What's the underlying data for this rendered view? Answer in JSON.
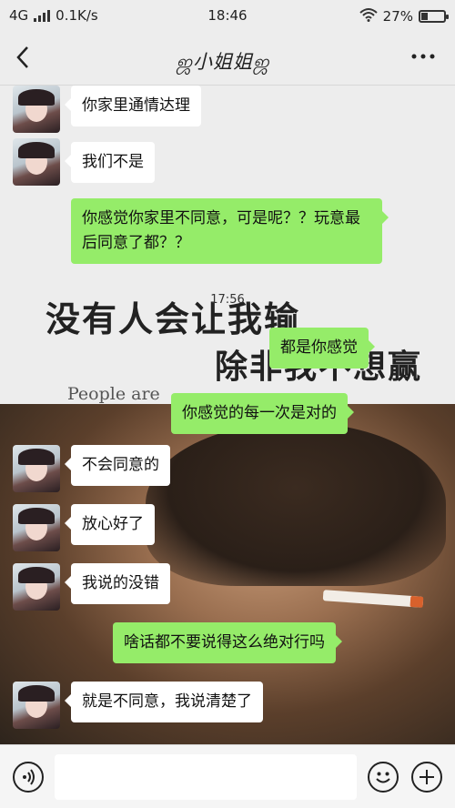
{
  "status": {
    "network": "4G",
    "speed": "0.1K/s",
    "time": "18:46",
    "battery": "27%",
    "battery_level": 0.27
  },
  "header": {
    "back_icon": "chevron-left-icon",
    "title": "ஜ小姐姐ஜ",
    "more_icon": "more-dots-icon"
  },
  "chat": {
    "timestamp": "17:56",
    "poster": {
      "line1": "没有人会让我输",
      "line2": "除非我不想赢",
      "line3": "People are"
    },
    "messages": [
      {
        "side": "in",
        "text": "你家里通情达理"
      },
      {
        "side": "in",
        "text": "我们不是"
      },
      {
        "side": "out",
        "text": "你感觉你家里不同意，可是呢？？玩意最后同意了都？？"
      },
      {
        "side": "out",
        "text": "都是你感觉"
      },
      {
        "side": "out",
        "text": "你感觉的每一次是对的"
      },
      {
        "side": "in",
        "text": "不会同意的"
      },
      {
        "side": "in",
        "text": "放心好了"
      },
      {
        "side": "in",
        "text": "我说的没错"
      },
      {
        "side": "out",
        "text": "啥话都不要说得这么绝对行吗"
      },
      {
        "side": "in",
        "text": "就是不同意，我说清楚了"
      }
    ]
  },
  "composer": {
    "voice_icon": "voice-icon",
    "input_value": "",
    "emoji_icon": "emoji-icon",
    "plus_icon": "plus-icon"
  },
  "colors": {
    "outgoing_bubble": "#95ec69",
    "incoming_bubble": "#ffffff",
    "background": "#ededed"
  }
}
